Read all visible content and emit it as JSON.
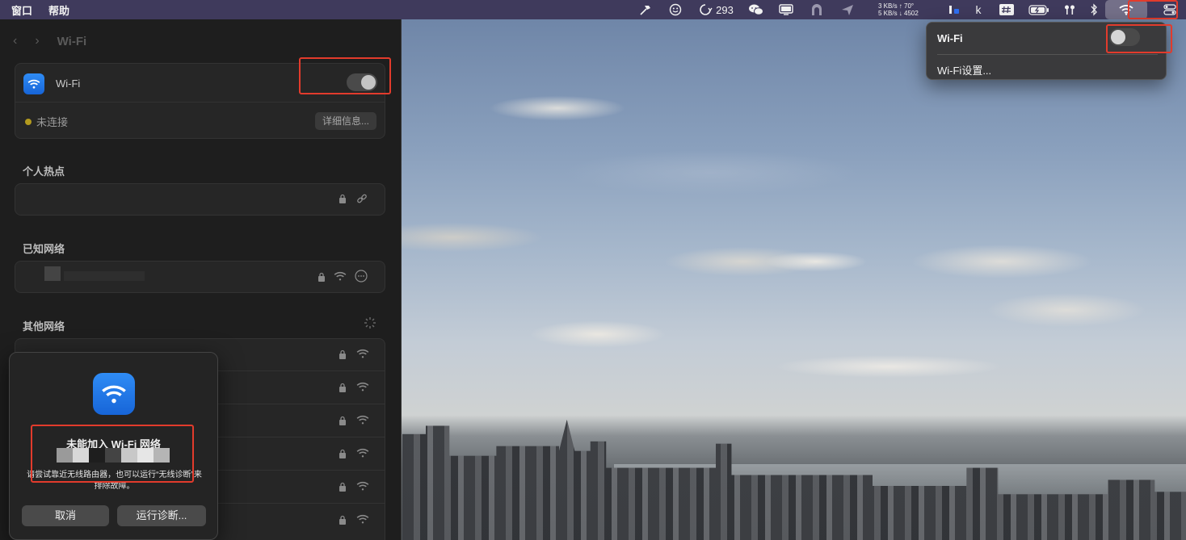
{
  "menubar": {
    "menus": [
      "窗口",
      "帮助"
    ],
    "badge_count": "293",
    "net_stats": {
      "line1": "3 KB/s ↑ 70°",
      "line2": "5 KB/s ↓ 4502"
    },
    "input_label": "k",
    "icons": [
      "hammer-icon",
      "smiley-icon",
      "chat-icon",
      "wechat-icon",
      "display-icon",
      "arch-icon",
      "send-icon",
      "keyboard-icon",
      "battery-icon",
      "airpods-icon",
      "bluetooth-icon",
      "wifi-icon",
      "control-center-icon"
    ]
  },
  "settings": {
    "nav_title": "Wi-Fi",
    "wifi_label": "Wi-Fi",
    "wifi_enabled": false,
    "status_text": "未连接",
    "details_button": "详细信息...",
    "hotspot_title": "个人热点",
    "known_title": "已知网络",
    "other_title": "其他网络"
  },
  "alert": {
    "title": "未能加入 Wi-Fi 网络",
    "message": "请尝试靠近无线路由器，也可以运行“无线诊断”来排除故障。",
    "cancel_button": "取消",
    "diagnose_button": "运行诊断..."
  },
  "wifi_menu": {
    "toggle_label": "Wi-Fi",
    "wifi_enabled": false,
    "settings_item": "Wi-Fi设置..."
  },
  "colors": {
    "menubar": "#3f3a5c",
    "wifi_blue": "#2f8cf5",
    "highlight_red": "#e23b2c",
    "status_dot": "#b39a1e"
  }
}
